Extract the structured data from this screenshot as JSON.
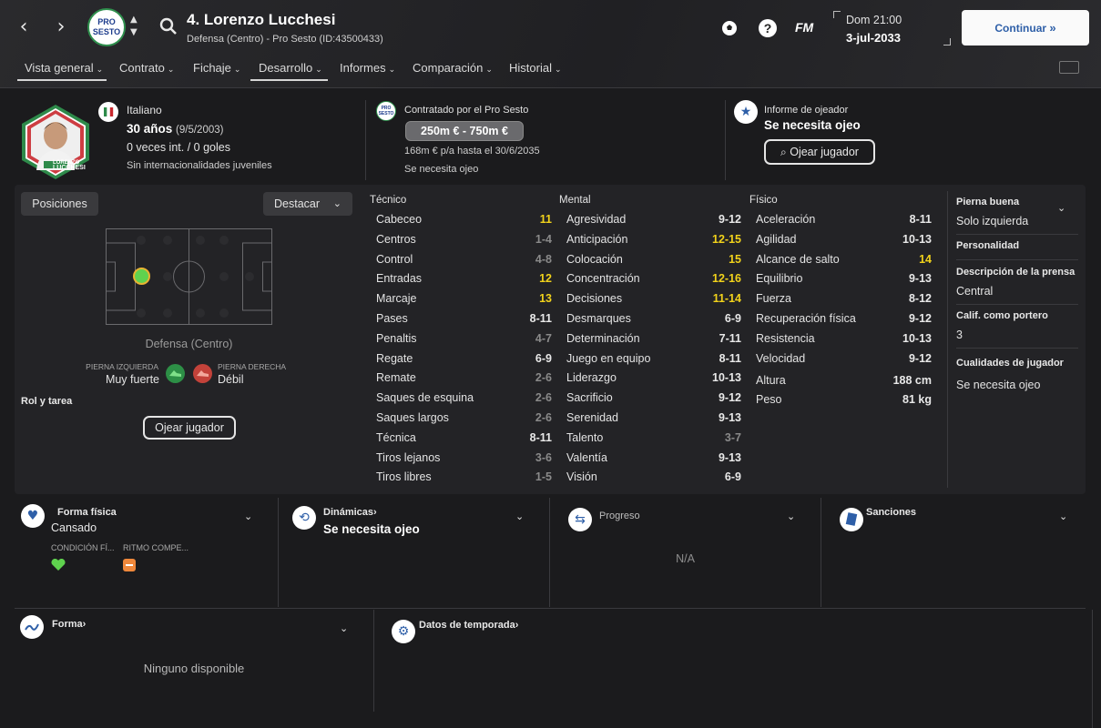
{
  "header": {
    "club_crest_text": "PRO SESTO",
    "player_title": "4. Lorenzo Lucchesi",
    "player_subtitle": "Defensa (Centro) - Pro Sesto (ID:43500433)",
    "fm_label": "FM",
    "date_time": "Dom 21:00",
    "date": "3-jul-2033",
    "continue_label": "Continuar"
  },
  "tabs": [
    {
      "label": "Vista general"
    },
    {
      "label": "Contrato"
    },
    {
      "label": "Fichaje"
    },
    {
      "label": "Desarrollo"
    },
    {
      "label": "Informes"
    },
    {
      "label": "Comparación"
    },
    {
      "label": "Historial"
    }
  ],
  "profile": {
    "nationality": "Italiano",
    "age": "30 años",
    "dob": "(9/5/2003)",
    "caps": "0 veces int. / 0 goles",
    "youth": "Sin internacionalidades juveniles",
    "shirt_name": "LUCCHESI",
    "shirt_small": "LORENZO"
  },
  "contract": {
    "title": "Contratado por el Pro Sesto",
    "value_range": "250m € - 750m €",
    "wage": "168m € p/a hasta el 30/6/2035",
    "note": "Se necesita ojeo"
  },
  "scout": {
    "title": "Informe de ojeador",
    "status": "Se necesita ojeo",
    "button": "Ojear jugador"
  },
  "positions": {
    "tab_label": "Posiciones",
    "highlight_label": "Destacar",
    "position_name": "Defensa (Centro)",
    "left_foot_label": "PIERNA IZQUIERDA",
    "left_foot_value": "Muy fuerte",
    "right_foot_label": "PIERNA DERECHA",
    "right_foot_value": "Débil",
    "role_label": "Rol y tarea",
    "scout_button": "Ojear jugador"
  },
  "attributes": {
    "technical_title": "Técnico",
    "mental_title": "Mental",
    "physical_title": "Físico",
    "technical": [
      {
        "name": "Cabeceo",
        "value": "11",
        "color": "y"
      },
      {
        "name": "Centros",
        "value": "1-4",
        "color": "g"
      },
      {
        "name": "Control",
        "value": "4-8",
        "color": "g"
      },
      {
        "name": "Entradas",
        "value": "12",
        "color": "y"
      },
      {
        "name": "Marcaje",
        "value": "13",
        "color": "y"
      },
      {
        "name": "Pases",
        "value": "8-11",
        "color": "w"
      },
      {
        "name": "Penaltis",
        "value": "4-7",
        "color": "g"
      },
      {
        "name": "Regate",
        "value": "6-9",
        "color": "w"
      },
      {
        "name": "Remate",
        "value": "2-6",
        "color": "g"
      },
      {
        "name": "Saques de esquina",
        "value": "2-6",
        "color": "g"
      },
      {
        "name": "Saques largos",
        "value": "2-6",
        "color": "g"
      },
      {
        "name": "Técnica",
        "value": "8-11",
        "color": "w"
      },
      {
        "name": "Tiros lejanos",
        "value": "3-6",
        "color": "g"
      },
      {
        "name": "Tiros libres",
        "value": "1-5",
        "color": "g"
      }
    ],
    "mental": [
      {
        "name": "Agresividad",
        "value": "9-12",
        "color": "w"
      },
      {
        "name": "Anticipación",
        "value": "12-15",
        "color": "y"
      },
      {
        "name": "Colocación",
        "value": "15",
        "color": "y"
      },
      {
        "name": "Concentración",
        "value": "12-16",
        "color": "y"
      },
      {
        "name": "Decisiones",
        "value": "11-14",
        "color": "y"
      },
      {
        "name": "Desmarques",
        "value": "6-9",
        "color": "w"
      },
      {
        "name": "Determinación",
        "value": "7-11",
        "color": "w"
      },
      {
        "name": "Juego en equipo",
        "value": "8-11",
        "color": "w"
      },
      {
        "name": "Liderazgo",
        "value": "10-13",
        "color": "w"
      },
      {
        "name": "Sacrificio",
        "value": "9-12",
        "color": "w"
      },
      {
        "name": "Serenidad",
        "value": "9-13",
        "color": "w"
      },
      {
        "name": "Talento",
        "value": "3-7",
        "color": "g"
      },
      {
        "name": "Valentía",
        "value": "9-13",
        "color": "w"
      },
      {
        "name": "Visión",
        "value": "6-9",
        "color": "w"
      }
    ],
    "physical": [
      {
        "name": "Aceleración",
        "value": "8-11",
        "color": "w"
      },
      {
        "name": "Agilidad",
        "value": "10-13",
        "color": "w"
      },
      {
        "name": "Alcance de salto",
        "value": "14",
        "color": "y"
      },
      {
        "name": "Equilibrio",
        "value": "9-13",
        "color": "w"
      },
      {
        "name": "Fuerza",
        "value": "8-12",
        "color": "w"
      },
      {
        "name": "Recuperación física",
        "value": "9-12",
        "color": "w"
      },
      {
        "name": "Resistencia",
        "value": "10-13",
        "color": "w"
      },
      {
        "name": "Velocidad",
        "value": "9-12",
        "color": "w"
      }
    ],
    "height_label": "Altura",
    "height_value": "188 cm",
    "weight_label": "Peso",
    "weight_value": "81 kg"
  },
  "side": {
    "good_foot_label": "Pierna buena",
    "good_foot_value": "Solo izquierda",
    "personality_label": "Personalidad",
    "press_label": "Descripción de la prensa",
    "press_value": "Central",
    "gk_label": "Calif. como portero",
    "gk_value": "3",
    "qualities_label": "Cualidades de jugador",
    "qualities_value": "Se necesita ojeo"
  },
  "cards": {
    "fitness_title": "Forma física",
    "fitness_value": "Cansado",
    "condition_label": "CONDICIÓN FÍ...",
    "match_rhythm_label": "RITMO COMPE...",
    "dynamics_title": "Dinámicas",
    "dynamics_value": "Se necesita ojeo",
    "progress_title": "Progreso",
    "progress_value": "N/A",
    "sanctions_title": "Sanciones",
    "form_title": "Forma",
    "form_value": "Ninguno disponible",
    "season_title": "Datos de temporada"
  }
}
